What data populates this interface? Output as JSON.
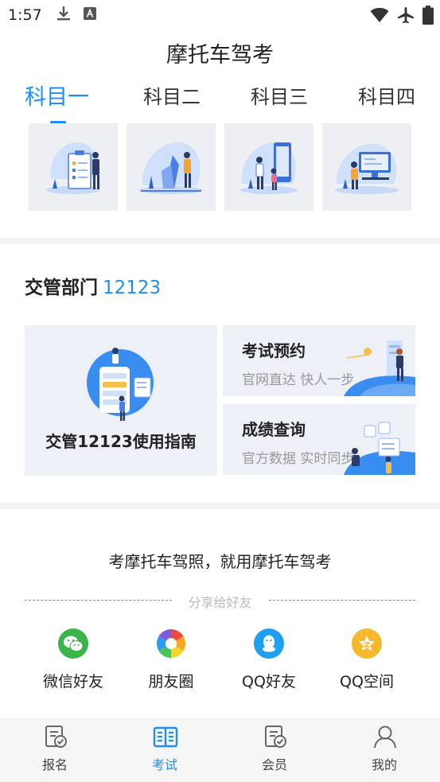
{
  "status_bar": {
    "time": "1:57",
    "left_icons": [
      "download-icon",
      "keyboard-a-icon"
    ],
    "right_icons": [
      "wifi-icon",
      "airplane-icon",
      "battery-icon"
    ]
  },
  "app": {
    "title": "摩托车驾考"
  },
  "subject_tabs": [
    {
      "label": "科目一",
      "active": true
    },
    {
      "label": "科目二",
      "active": false
    },
    {
      "label": "科目三",
      "active": false
    },
    {
      "label": "科目四",
      "active": false
    }
  ],
  "department": {
    "title": "交管部门",
    "number": "12123",
    "guide": {
      "label": "交管12123使用指南"
    },
    "exam_booking": {
      "title": "考试预约",
      "subtitle": "官网直达 快人一步"
    },
    "score_query": {
      "title": "成绩查询",
      "subtitle": "官方数据 实时同步"
    }
  },
  "promo": {
    "slogan": "考摩托车驾照，就用摩托车驾考",
    "share_label": "分享给好友"
  },
  "share_items": [
    {
      "label": "微信好友",
      "icon": "wechat-icon",
      "color": "#3bb54a"
    },
    {
      "label": "朋友圈",
      "icon": "moments-icon",
      "color": "#ffffff"
    },
    {
      "label": "QQ好友",
      "icon": "qq-icon",
      "color": "#1ea0f2"
    },
    {
      "label": "QQ空间",
      "icon": "qzone-icon",
      "color": "#f5b92b"
    }
  ],
  "bottom_nav": [
    {
      "label": "报名",
      "icon": "signup-icon",
      "active": false
    },
    {
      "label": "考试",
      "icon": "exam-book-icon",
      "active": true
    },
    {
      "label": "会员",
      "icon": "member-icon",
      "active": false
    },
    {
      "label": "我的",
      "icon": "profile-icon",
      "active": false
    }
  ],
  "colors": {
    "accent": "#1e8ef5",
    "card_bg": "#edf0f6",
    "divider": "#f2f3f5"
  }
}
